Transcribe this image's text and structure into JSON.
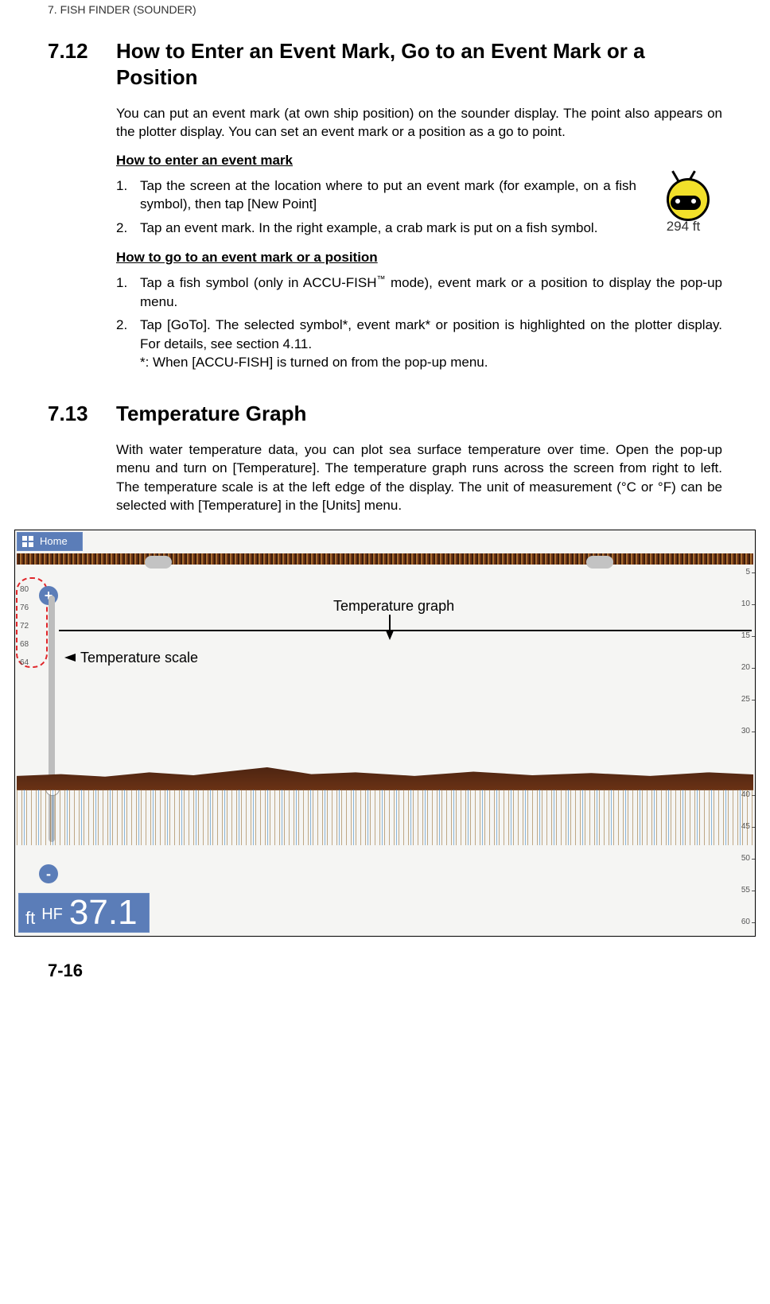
{
  "breadcrumb": "7.  FISH FINDER (SOUNDER)",
  "section_7_12": {
    "number": "7.12",
    "title": "How to Enter an Event Mark, Go to an Event Mark or a Position",
    "intro": "You can put an event mark (at own ship position) on the sounder display. The point also appears on the plotter display. You can set an event mark or a position as a go to point.",
    "sub1": "How to enter an event mark",
    "list1": {
      "n1": "1.",
      "i1": "Tap the screen at the location where to put an event mark (for example, on a fish symbol), then tap [New Point]",
      "n2": "2.",
      "i2": "Tap an event mark. In the right example, a crab mark is put on a fish symbol."
    },
    "crab_label": "294 ft",
    "sub2": "How to go to an event mark or a position",
    "list2": {
      "n1": "1.",
      "i1a": "Tap a fish symbol (only in ACCU-FISH",
      "i1b": " mode), event mark or a position to display the pop-up menu.",
      "n2": "2.",
      "i2": "Tap [GoTo]. The selected symbol*, event mark* or position is highlighted on the plotter display. For details, see section 4.11.\n*: When [ACCU-FISH] is turned on from the pop-up menu."
    }
  },
  "section_7_13": {
    "number": "7.13",
    "title": "Temperature Graph",
    "intro": "With water temperature data, you can plot sea surface temperature over time. Open the pop-up menu and turn on [Temperature]. The temperature graph runs across the screen from right to left. The temperature scale is at the left edge of the display. The unit of measurement (°C or °F) can be selected with [Temperature] in the [Units] menu."
  },
  "figure": {
    "home": "Home",
    "temp_scale_label": "Temperature scale",
    "temp_graph_label": "Temperature graph",
    "temp_ticks": {
      "t80": "80",
      "t76": "76",
      "t72": "72",
      "t68": "68",
      "t64": "64"
    },
    "depth_ticks": {
      "d5": "5",
      "d10": "10",
      "d15": "15",
      "d20": "20",
      "d25": "25",
      "d30": "30",
      "d40": "40",
      "d45": "45",
      "d50": "50",
      "d55": "55",
      "d60": "60"
    },
    "depth_box": {
      "unit": "ft",
      "mode": "HF",
      "value": "37.1"
    },
    "plus": "+",
    "minus": "-"
  },
  "page_number": "7-16"
}
